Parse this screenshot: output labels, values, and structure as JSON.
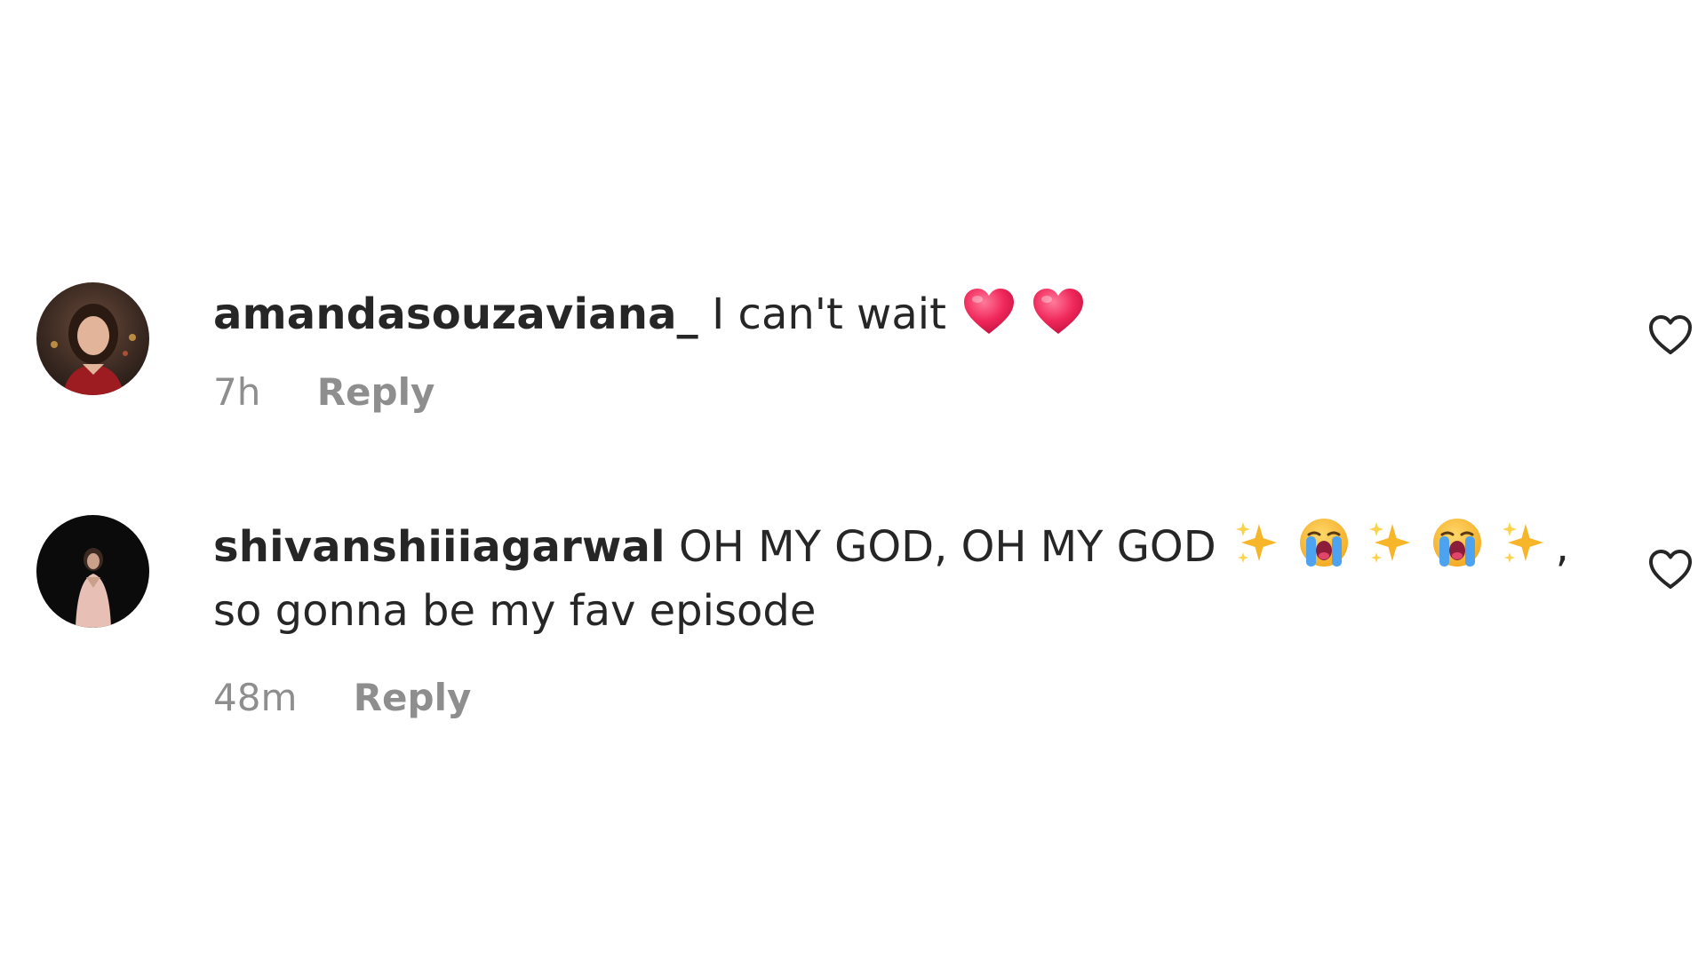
{
  "comments": [
    {
      "username": "amandasouzaviana_",
      "text": "I can't wait",
      "emojis": [
        "red-heart",
        "red-heart"
      ],
      "time": "7h",
      "reply_label": "Reply"
    },
    {
      "username": "shivanshiiiagarwal",
      "text": "OH MY GOD, OH MY GOD",
      "emojis": [
        "sparkles",
        "loudly-crying-face",
        "sparkles",
        "loudly-crying-face",
        "sparkles"
      ],
      "trailing": ",",
      "text_line2": "so gonna be my fav episode",
      "time": "48m",
      "reply_label": "Reply"
    }
  ],
  "icons": {
    "like": "heart-outline-icon"
  },
  "colors": {
    "text": "#262626",
    "meta": "#8e8e8e",
    "heart_emoji": "#f0285a"
  }
}
